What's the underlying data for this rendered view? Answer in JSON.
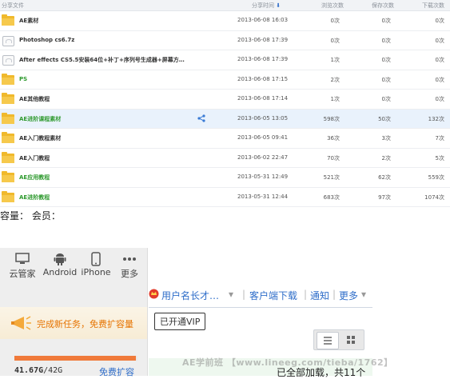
{
  "table": {
    "headers": {
      "name": "分享文件",
      "time": "分享时间",
      "views": "浏览次数",
      "saves": "保存次数",
      "downloads": "下载次数"
    },
    "rows": [
      {
        "name": "AE素材",
        "date": "2013-06-08 16:03",
        "views": "0次",
        "saves": "0次",
        "downloads": "0次",
        "type": "folder",
        "green": false
      },
      {
        "name": "Photoshop cs6.7z",
        "date": "2013-06-08 17:39",
        "views": "0次",
        "saves": "0次",
        "downloads": "0次",
        "type": "file",
        "green": false
      },
      {
        "name": "After effects CS5.5安装64位+补丁+序列号生成器+屏幕方…",
        "date": "2013-06-08 17:39",
        "views": "1次",
        "saves": "0次",
        "downloads": "0次",
        "type": "file",
        "green": false
      },
      {
        "name": "PS",
        "date": "2013-06-08 17:15",
        "views": "2次",
        "saves": "0次",
        "downloads": "0次",
        "type": "folder",
        "green": true
      },
      {
        "name": "AE其他教程",
        "date": "2013-06-08 17:14",
        "views": "1次",
        "saves": "0次",
        "downloads": "0次",
        "type": "folder",
        "green": false
      },
      {
        "name": "AE进阶课程素材",
        "date": "2013-06-05 13:05",
        "views": "598次",
        "saves": "50次",
        "downloads": "132次",
        "type": "folder",
        "green": true,
        "selected": true
      },
      {
        "name": "AE入门教程素材",
        "date": "2013-06-05 09:41",
        "views": "36次",
        "saves": "3次",
        "downloads": "7次",
        "type": "folder",
        "green": false
      },
      {
        "name": "AE入门教程",
        "date": "2013-06-02 22:47",
        "views": "70次",
        "saves": "2次",
        "downloads": "5次",
        "type": "folder",
        "green": false
      },
      {
        "name": "AE应用教程",
        "date": "2013-05-31 12:49",
        "views": "521次",
        "saves": "62次",
        "downloads": "559次",
        "type": "folder",
        "green": true
      },
      {
        "name": "AE进阶教程",
        "date": "2013-05-31 12:44",
        "views": "683次",
        "saves": "97次",
        "downloads": "1074次",
        "type": "folder",
        "green": true
      }
    ]
  },
  "caption": "容量： 会员：",
  "left_panel": {
    "devices": [
      "云管家",
      "Android",
      "iPhone",
      "更多"
    ],
    "task_text": "完成新任务，免费扩容量",
    "quota_used": "41.67G",
    "quota_total": "/42G",
    "quota_fill": 0.99,
    "expand_label": "免费扩容"
  },
  "right_panel": {
    "username": "用户名长才…",
    "client_download": "客户端下载",
    "notify": "通知",
    "more": "更多",
    "vip_tooltip": "已开通VIP",
    "loaded_text": "已全部加载，共11个",
    "watermark": "AE学前班  【www.lineeg.com/tieba/1762】"
  },
  "colors": {
    "accent": "#2e6dc9",
    "green": "#2f9a2f",
    "orange": "#f07a3a",
    "folder": "#f0b92c"
  }
}
